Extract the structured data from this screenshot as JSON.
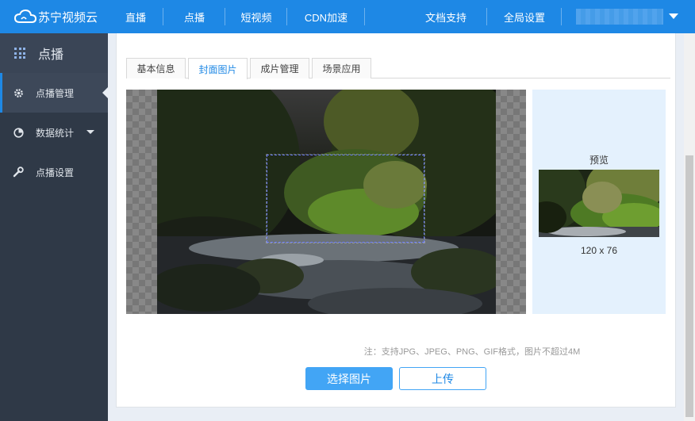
{
  "header": {
    "logo_text": "苏宁视频云",
    "nav": [
      "直播",
      "点播",
      "短视频",
      "CDN加速"
    ],
    "nav_right": [
      "文档支持",
      "全局设置"
    ]
  },
  "sidebar": {
    "title": "点播",
    "items": [
      {
        "label": "点播管理",
        "icon": "gear-icon"
      },
      {
        "label": "数据统计",
        "icon": "pie-chart-icon"
      },
      {
        "label": "点播设置",
        "icon": "wrench-icon"
      }
    ]
  },
  "tabs": [
    {
      "label": "基本信息"
    },
    {
      "label": "封面图片"
    },
    {
      "label": "成片管理"
    },
    {
      "label": "场景应用"
    }
  ],
  "preview": {
    "title": "预览",
    "size": "120 x 76"
  },
  "note": "注：支持JPG、JPEG、PNG、GIF格式，图片不超过4M",
  "buttons": {
    "select": "选择图片",
    "upload": "上传"
  }
}
